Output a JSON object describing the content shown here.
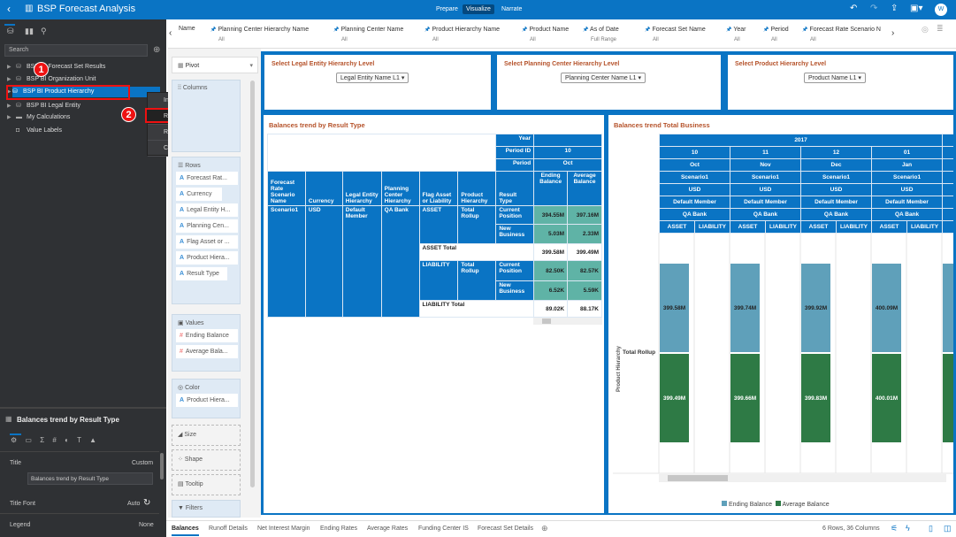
{
  "header": {
    "title": "BSP Forecast Analysis",
    "modes": [
      "Prepare",
      "Visualize",
      "Narrate"
    ],
    "active_mode": "Visualize",
    "avatar": "W"
  },
  "data_panel": {
    "search_placeholder": "Search",
    "items": [
      {
        "label": "BSP BI Forecast Set Results",
        "icon": "database-icon"
      },
      {
        "label": "BSP BI Organization Unit",
        "icon": "database-icon"
      },
      {
        "label": "BSP BI Product Hierarchy",
        "icon": "database-icon",
        "selected": true
      },
      {
        "label": "BSP BI Legal Entity",
        "icon": "database-icon"
      },
      {
        "label": "My Calculations",
        "icon": "folder-icon"
      },
      {
        "label": "Value Labels",
        "icon": "tag-icon"
      }
    ]
  },
  "annotations": {
    "step1": "1",
    "step2": "2"
  },
  "context_menu": {
    "items": [
      "Inspect",
      "Reload Data",
      "Remove from Project",
      "Create Scenario..."
    ],
    "highlighted": "Reload Data"
  },
  "properties": {
    "viz_title": "Balances trend by Result Type",
    "title_label": "Title",
    "title_mode": "Custom",
    "title_value": "Balances trend by Result Type",
    "title_font_label": "Title Font",
    "title_font_value": "Auto",
    "legend_label": "Legend",
    "legend_value": "None"
  },
  "filters": [
    {
      "name": "Name",
      "value": ""
    },
    {
      "name": "Planning Center Hierarchy Name",
      "value": "All"
    },
    {
      "name": "Planning Center Name",
      "value": "All"
    },
    {
      "name": "Product Hierarchy Name",
      "value": "All"
    },
    {
      "name": "Product Name",
      "value": "All"
    },
    {
      "name": "As of Date",
      "value": "Full Range"
    },
    {
      "name": "Forecast Set Name",
      "value": "All"
    },
    {
      "name": "Year",
      "value": "All"
    },
    {
      "name": "Period",
      "value": "All"
    },
    {
      "name": "Forecast Rate Scenario N",
      "value": "All"
    }
  ],
  "grammar": {
    "viz_type": "Pivot",
    "columns": "Columns",
    "rows_label": "Rows",
    "rows": [
      "Forecast Rat...",
      "Currency",
      "Legal Entity H...",
      "Planning Cen...",
      "Flag Asset or ...",
      "Product Hiera...",
      "Result Type"
    ],
    "values_label": "Values",
    "values": [
      "Ending Balance",
      "Average Bala..."
    ],
    "color_label": "Color",
    "color": [
      "Product Hiera..."
    ],
    "size": "Size",
    "shape": "Shape",
    "tooltip": "Tooltip",
    "filters": "Filters"
  },
  "selectors": [
    {
      "title": "Select Legal Entity Hierarchy Level",
      "value": "Legal Entity Name L1"
    },
    {
      "title": "Select Planning Center Hierarchy Level",
      "value": "Planning Center Name L1"
    },
    {
      "title": "Select Product Hierarchy Level",
      "value": "Product Name L1"
    }
  ],
  "pivot": {
    "title": "Balances trend by Result Type",
    "col_headers": {
      "year": "Year",
      "period_id": "Period ID",
      "period_id_value": "10",
      "period": "Period",
      "period_value": "Oct"
    },
    "row_headers": [
      "Forecast Rate Scenario Name",
      "Currency",
      "Legal Entity Hierarchy",
      "Planning Center Hierarchy",
      "Flag Asset or Liability",
      "Product Hierarchy",
      "Result Type",
      "Ending Balance",
      "Average Balance"
    ],
    "scenario": "Scenario1",
    "currency": "USD",
    "legal_entity": "Default Member",
    "planning_center": "QA Bank",
    "asset": {
      "flag": "ASSET",
      "product": "Total Rollup",
      "current_label": "Current Position",
      "current_end": "394.55M",
      "current_avg": "397.16M",
      "new_label": "New Business",
      "new_end": "5.03M",
      "new_avg": "2.33M",
      "total_label": "ASSET Total",
      "total_end": "399.58M",
      "total_avg": "399.49M"
    },
    "liability": {
      "flag": "LIABILITY",
      "product": "Total Rollup",
      "current_label": "Current Position",
      "current_end": "82.50K",
      "current_avg": "82.57K",
      "new_label": "New Business",
      "new_end": "6.52K",
      "new_avg": "5.59K",
      "total_label": "LIABILITY Total",
      "total_end": "89.02K",
      "total_avg": "88.17K"
    }
  },
  "chart_data": {
    "type": "bar",
    "title": "Balances trend Total Business",
    "year": "2017",
    "periods": [
      {
        "id": "10",
        "name": "Oct"
      },
      {
        "id": "11",
        "name": "Nov"
      },
      {
        "id": "12",
        "name": "Dec"
      },
      {
        "id": "01",
        "name": "Jan"
      }
    ],
    "header_rows": [
      "Scenario1",
      "USD",
      "Default Member",
      "QA Bank"
    ],
    "sub_columns": [
      "ASSET",
      "LIABILITY"
    ],
    "row_label": "Total Rollup",
    "ylabel": "Product Hierarchy",
    "series": [
      {
        "name": "Ending Balance",
        "color": "#5fa0ba",
        "labels": [
          "399.58M",
          "399.74M",
          "399.92M",
          "400.09M"
        ],
        "values": [
          399.58,
          399.74,
          399.92,
          400.09
        ]
      },
      {
        "name": "Average Balance",
        "color": "#2e7a45",
        "labels": [
          "399.49M",
          "399.66M",
          "399.83M",
          "400.01M"
        ],
        "values": [
          399.49,
          399.66,
          399.83,
          400.01
        ]
      }
    ],
    "legend_position": "bottom"
  },
  "bottom": {
    "tabs": [
      "Balances",
      "Runoff Details",
      "Net Interest Margin",
      "Ending Rates",
      "Average Rates",
      "Funding Center IS",
      "Forecast Set Details"
    ],
    "active": "Balances",
    "status": "6 Rows, 36 Columns"
  }
}
